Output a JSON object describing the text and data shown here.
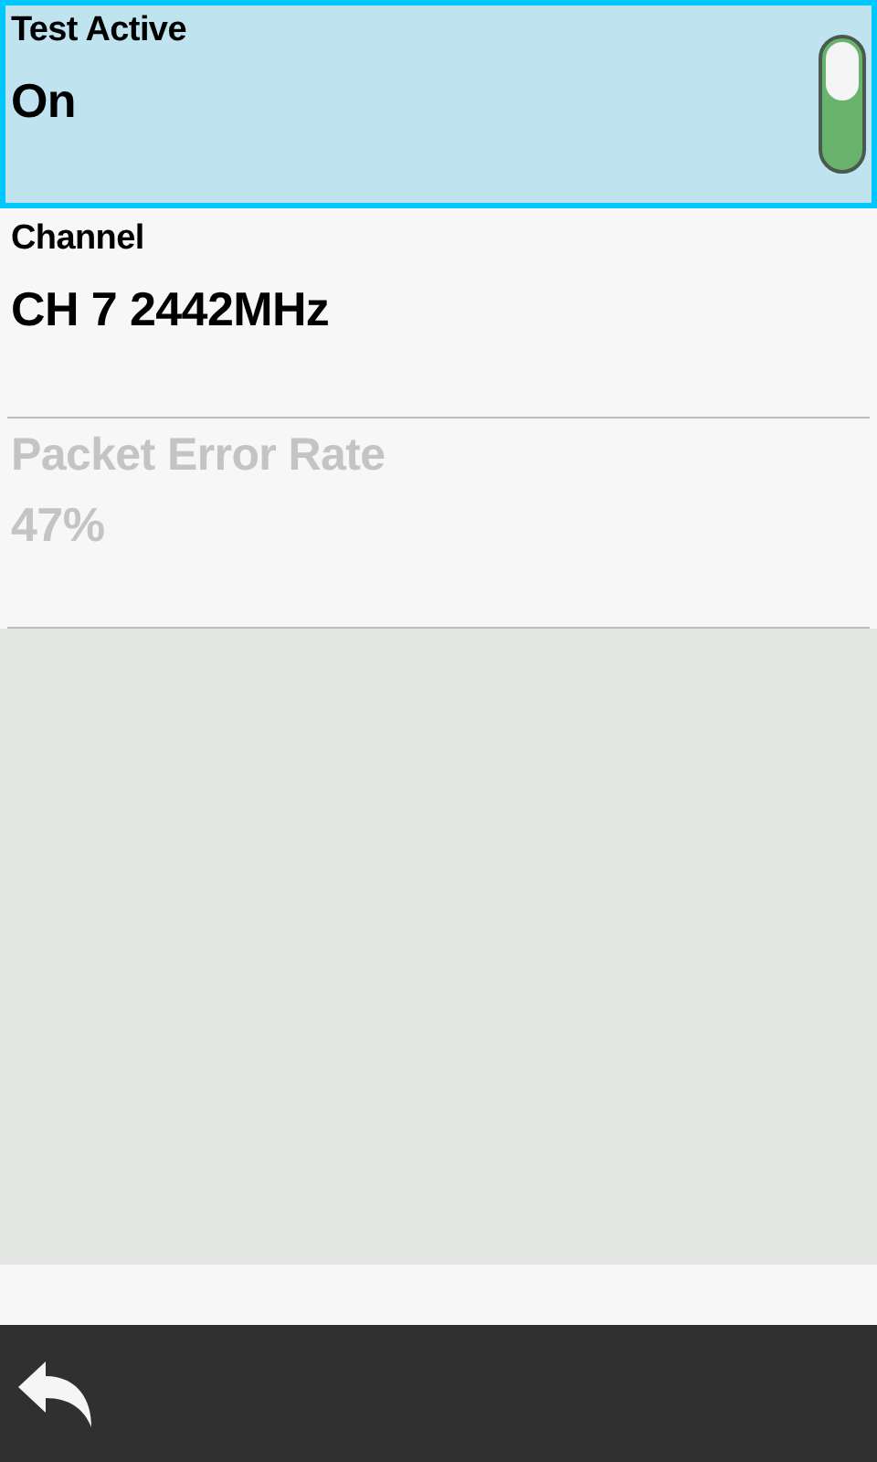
{
  "items": [
    {
      "kind": "toggle",
      "label": "Test Active",
      "value": "On",
      "selected": true,
      "disabled": false,
      "on": true
    },
    {
      "kind": "value",
      "label": "Channel",
      "value": "CH 7 2442MHz",
      "selected": false,
      "disabled": false
    },
    {
      "kind": "value",
      "label": "Packet Error Rate",
      "value": "47%",
      "selected": false,
      "disabled": true
    }
  ]
}
